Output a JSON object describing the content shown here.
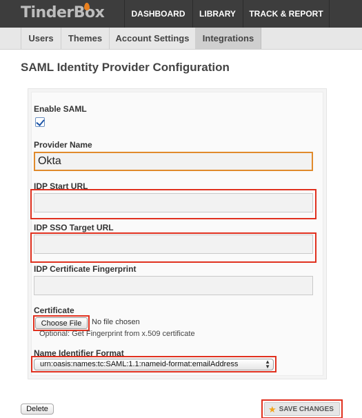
{
  "app": {
    "logo_text": "TinderBox"
  },
  "nav": {
    "items": [
      "DASHBOARD",
      "LIBRARY",
      "TRACK & REPORT"
    ]
  },
  "subnav": {
    "tabs": [
      "Users",
      "Themes",
      "Account Settings",
      "Integrations"
    ],
    "active": "Integrations"
  },
  "page": {
    "title": "SAML Identity Provider Configuration"
  },
  "form": {
    "enable_saml": {
      "label": "Enable SAML",
      "checked": true
    },
    "provider_name": {
      "label": "Provider Name",
      "value": "Okta"
    },
    "idp_start_url": {
      "label": "IDP Start URL",
      "value": ""
    },
    "idp_sso_target_url": {
      "label": "IDP SSO Target URL",
      "value": ""
    },
    "idp_cert_fingerprint": {
      "label": "IDP Certificate Fingerprint",
      "value": ""
    },
    "certificate": {
      "label": "Certificate",
      "button_label": "Choose File",
      "file_status": "No file chosen",
      "hint": "Optional: Get Fingerprint from x.509 certificate"
    },
    "name_identifier_format": {
      "label": "Name Identifier Format",
      "selected": "urn:oasis:names:tc:SAML:1.1:nameid-format:emailAddress"
    }
  },
  "actions": {
    "delete_label": "Delete",
    "save_label": "SAVE CHANGES"
  },
  "colors": {
    "topbar": "#3d3d3d",
    "highlight": "#e0301e",
    "focus_border": "#e08a2b",
    "save_star": "#f1a51a"
  },
  "icons": {
    "save": "star-icon",
    "checkbox": "checkmark-icon",
    "select": "updown-arrows-icon"
  }
}
